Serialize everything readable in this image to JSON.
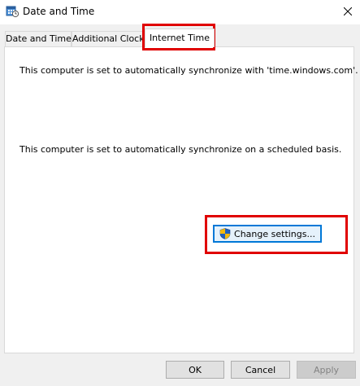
{
  "window": {
    "title": "Date and Time",
    "icon": "date-time-control-panel-icon",
    "close_icon": "close-icon"
  },
  "tabs": [
    {
      "label": "Date and Time",
      "active": false
    },
    {
      "label": "Additional Clocks",
      "active": false
    },
    {
      "label": "Internet Time",
      "active": true
    }
  ],
  "panel": {
    "sync_server_text": "This computer is set to automatically synchronize with 'time.windows.com'.",
    "sync_schedule_text": "This computer is set to automatically synchronize on a scheduled basis.",
    "change_settings_label": "Change settings...",
    "change_settings_icon": "uac-shield-icon"
  },
  "footer": {
    "ok_label": "OK",
    "cancel_label": "Cancel",
    "apply_label": "Apply",
    "apply_disabled": true
  },
  "annotations": {
    "highlight_color": "#e00000"
  }
}
